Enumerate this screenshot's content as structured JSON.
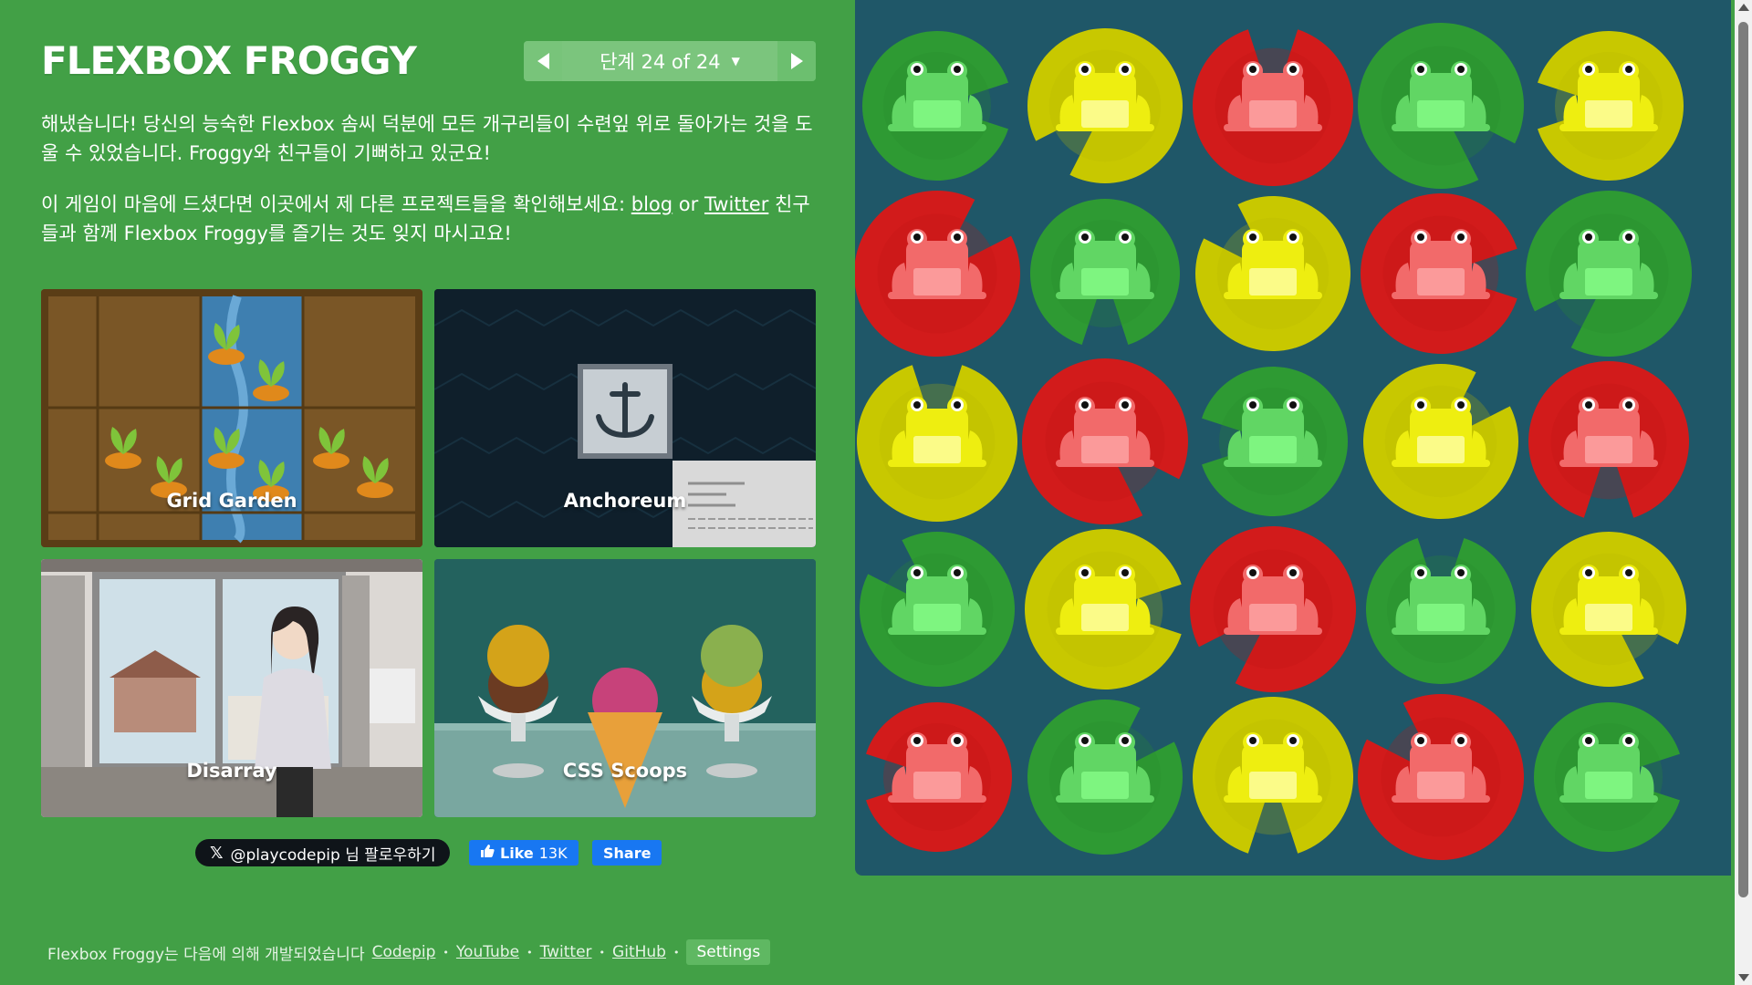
{
  "app": {
    "title": "FLEXBOX FROGGY",
    "level_label": "단계 24 of 24",
    "level_caret": "▼"
  },
  "message": {
    "p1": "해냈습니다! 당신의 능숙한 Flexbox 솜씨 덕분에 모든 개구리들이 수련잎 위로 돌아가는 것을 도울 수 있었습니다. Froggy와 친구들이 기뻐하고 있군요!",
    "p2_before": "이 게임이 마음에 드셨다면 이곳에서 제 다른 프로젝트들을 확인해보세요: ",
    "p2_link1": "blog",
    "p2_or": " or ",
    "p2_link2": "Twitter",
    "p2_after": " 친구들과 함께 Flexbox Froggy를 즐기는 것도 잊지 마시고요!"
  },
  "projects": [
    {
      "label": "Grid Garden"
    },
    {
      "label": "Anchoreum"
    },
    {
      "label": "Disarray"
    },
    {
      "label": "CSS Scoops"
    }
  ],
  "social": {
    "x_follow": "@playcodepip 님 팔로우하기",
    "fb_like": "Like",
    "fb_count": "13K",
    "fb_share": "Share"
  },
  "footer": {
    "text": "Flexbox Froggy는 다음에 의해 개발되었습니다",
    "links": [
      "Codepip",
      "YouTube",
      "Twitter",
      "GitHub"
    ],
    "settings": "Settings"
  },
  "board": {
    "colors": {
      "green": "#2e9a33",
      "yellow": "#c8c800",
      "red": "#d21b1b",
      "background": "#1f5768"
    },
    "grid": [
      [
        "green",
        "yellow",
        "red",
        "green",
        "yellow"
      ],
      [
        "red",
        "green",
        "yellow",
        "red",
        "green"
      ],
      [
        "yellow",
        "red",
        "green",
        "yellow",
        "red"
      ],
      [
        "green",
        "yellow",
        "red",
        "green",
        "yellow"
      ],
      [
        "red",
        "green",
        "yellow",
        "red",
        "green"
      ]
    ]
  }
}
